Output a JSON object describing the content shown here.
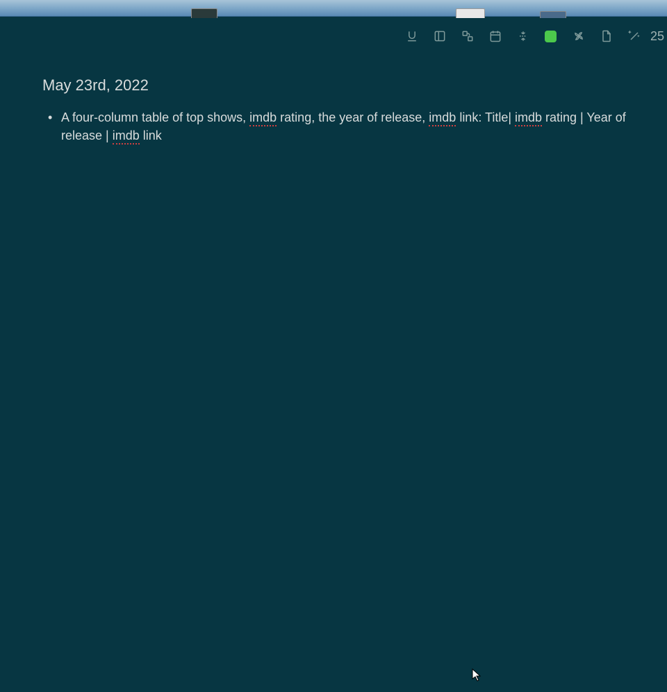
{
  "date_heading": "May 23rd, 2022",
  "toolbar": {
    "counter": "25",
    "swatch_color": "#4cc84c"
  },
  "note": {
    "text_parts": [
      "A four-column  table of top shows, ",
      "imdb",
      " rating, the year of release, ",
      "imdb",
      " link: Title| ",
      "imdb",
      " rating | Year of release | ",
      "imdb",
      " link"
    ]
  }
}
